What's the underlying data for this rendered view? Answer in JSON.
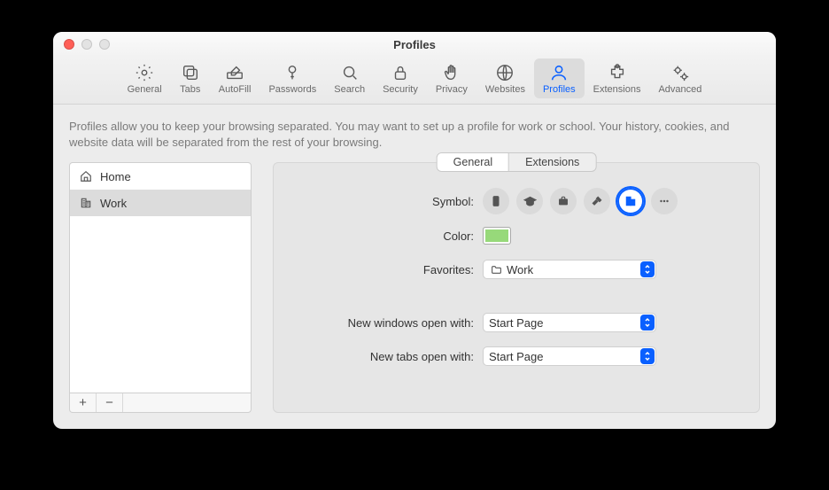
{
  "window": {
    "title": "Profiles"
  },
  "toolbar": {
    "items": [
      {
        "label": "General"
      },
      {
        "label": "Tabs"
      },
      {
        "label": "AutoFill"
      },
      {
        "label": "Passwords"
      },
      {
        "label": "Search"
      },
      {
        "label": "Security"
      },
      {
        "label": "Privacy"
      },
      {
        "label": "Websites"
      },
      {
        "label": "Profiles"
      },
      {
        "label": "Extensions"
      },
      {
        "label": "Advanced"
      }
    ],
    "selected_index": 8
  },
  "intro_text": "Profiles allow you to keep your browsing separated. You may want to set up a profile for work or school. Your history, cookies, and website data will be separated from the rest of your browsing.",
  "sidebar": {
    "items": [
      {
        "label": "Home"
      },
      {
        "label": "Work"
      }
    ],
    "selected_index": 1,
    "add_label": "+",
    "remove_label": "−"
  },
  "segmented": {
    "options": [
      "General",
      "Extensions"
    ],
    "selected_index": 0
  },
  "form": {
    "symbol_label": "Symbol:",
    "color_label": "Color:",
    "favorites_label": "Favorites:",
    "new_windows_label": "New windows open with:",
    "new_tabs_label": "New tabs open with:",
    "favorites_value": "Work",
    "new_windows_value": "Start Page",
    "new_tabs_value": "Start Page",
    "color_value": "#97d97a",
    "symbols": [
      "id-badge",
      "graduation-cap",
      "briefcase",
      "hammer",
      "building",
      "ellipsis"
    ],
    "symbol_selected_index": 4
  }
}
